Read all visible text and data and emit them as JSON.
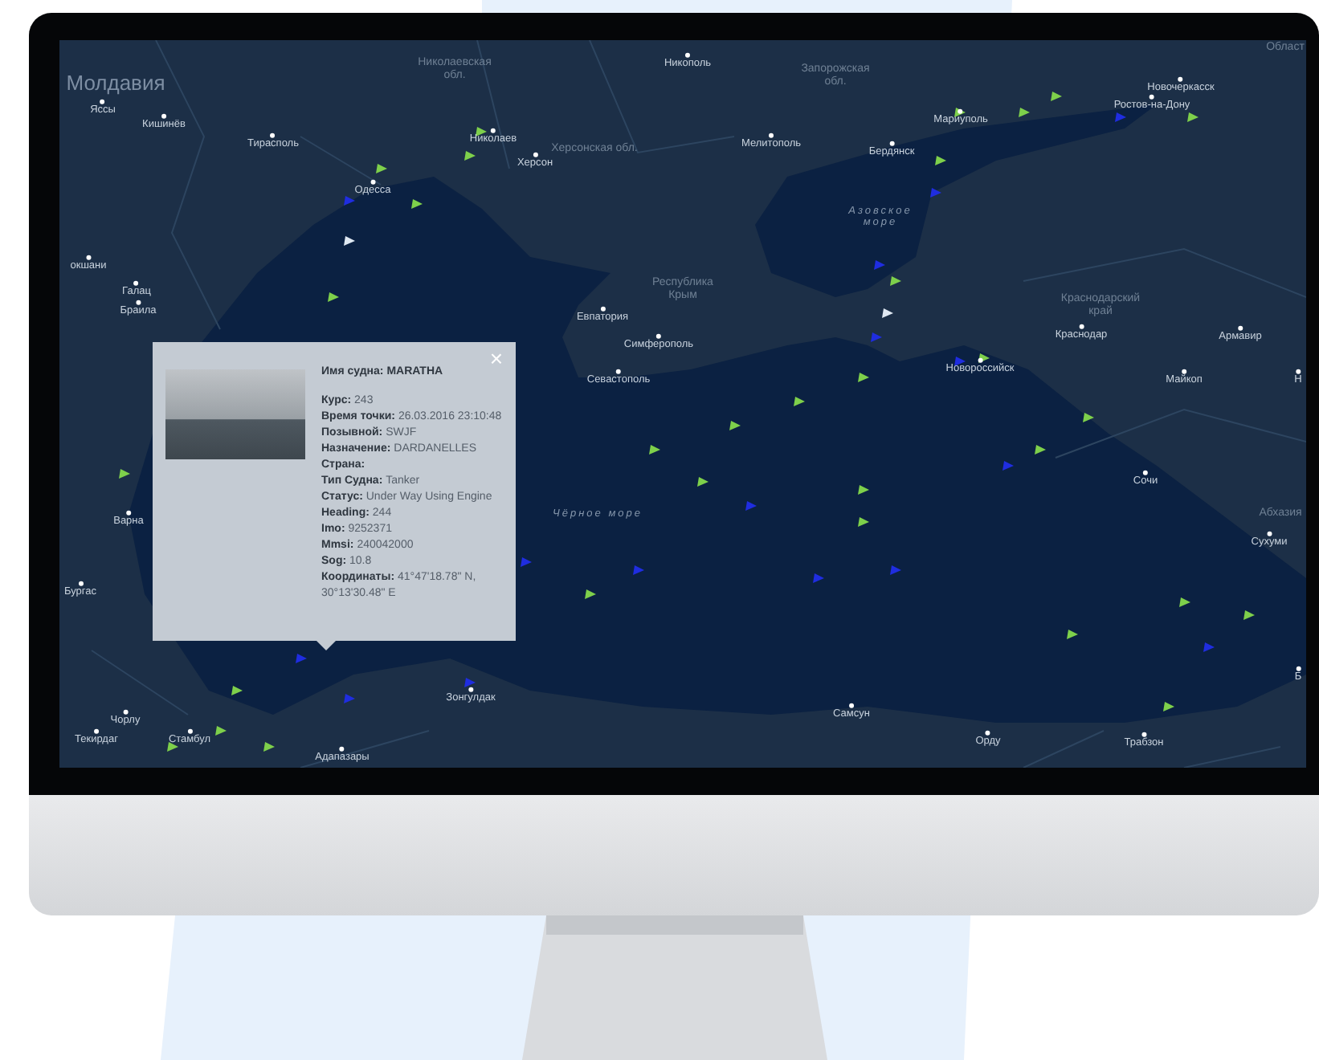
{
  "map": {
    "labels": [
      {
        "text": "Молдавия",
        "kind": "country"
      },
      {
        "text": "Яссы",
        "kind": "city"
      },
      {
        "text": "Кишинёв",
        "kind": "city"
      },
      {
        "text": "Тирасполь",
        "kind": "city"
      },
      {
        "text": "Николаевская обл.",
        "kind": "region"
      },
      {
        "text": "Николаев",
        "kind": "city"
      },
      {
        "text": "Херсон",
        "kind": "city"
      },
      {
        "text": "Херсонская обл.",
        "kind": "region"
      },
      {
        "text": "Одесса",
        "kind": "city"
      },
      {
        "text": "Никополь",
        "kind": "city"
      },
      {
        "text": "Запорожская обл.",
        "kind": "region"
      },
      {
        "text": "Мелитополь",
        "kind": "city"
      },
      {
        "text": "Бердянск",
        "kind": "city"
      },
      {
        "text": "Мариуполь",
        "kind": "city"
      },
      {
        "text": "Новочеркасск",
        "kind": "city"
      },
      {
        "text": "Ростов-на-Дону",
        "kind": "city"
      },
      {
        "text": "Област",
        "kind": "region"
      },
      {
        "text": "окшани",
        "kind": "city"
      },
      {
        "text": "Галац",
        "kind": "city"
      },
      {
        "text": "Браила",
        "kind": "city"
      },
      {
        "text": "Азовское море",
        "kind": "sea"
      },
      {
        "text": "Республика Крым",
        "kind": "region"
      },
      {
        "text": "Евпатория",
        "kind": "city"
      },
      {
        "text": "Симферополь",
        "kind": "city"
      },
      {
        "text": "Севастополь",
        "kind": "city"
      },
      {
        "text": "Краснодарский край",
        "kind": "region"
      },
      {
        "text": "Краснодар",
        "kind": "city"
      },
      {
        "text": "Армавир",
        "kind": "city"
      },
      {
        "text": "Новороссийск",
        "kind": "city"
      },
      {
        "text": "Майкоп",
        "kind": "city"
      },
      {
        "text": "Н",
        "kind": "city"
      },
      {
        "text": "Сочи",
        "kind": "city"
      },
      {
        "text": "Абхазия",
        "kind": "region"
      },
      {
        "text": "Сухуми",
        "kind": "city"
      },
      {
        "text": "Чёрное море",
        "kind": "sea"
      },
      {
        "text": "Варна",
        "kind": "city"
      },
      {
        "text": "Бургас",
        "kind": "city"
      },
      {
        "text": "Зонгулдак",
        "kind": "city"
      },
      {
        "text": "Б",
        "kind": "city"
      },
      {
        "text": "Чорлу",
        "kind": "city"
      },
      {
        "text": "Текирдаг",
        "kind": "city"
      },
      {
        "text": "Стамбул",
        "kind": "city"
      },
      {
        "text": "Адапазары",
        "kind": "city"
      },
      {
        "text": "Самсун",
        "kind": "city"
      },
      {
        "text": "Орду",
        "kind": "city"
      },
      {
        "text": "Трабзон",
        "kind": "city"
      }
    ],
    "popup": {
      "close": "×",
      "fields": [
        {
          "label": "Имя судна:",
          "value": "MARATHA"
        },
        {
          "label": "Курс:",
          "value": "243"
        },
        {
          "label": "Время точки:",
          "value": "26.03.2016 23:10:48"
        },
        {
          "label": "Позывной:",
          "value": "SWJF"
        },
        {
          "label": "Назначение:",
          "value": "DARDANELLES"
        },
        {
          "label": "Страна:"
        },
        {
          "label": "Тип Судна:",
          "value": "Tanker"
        },
        {
          "label": "Статус:",
          "value": "Under Way Using Engine"
        },
        {
          "label": "Heading:",
          "value": "244"
        },
        {
          "label": "Imo:",
          "value": "9252371"
        },
        {
          "label": "Mmsi:",
          "value": "240042000"
        },
        {
          "label": "Sog:",
          "value": "10.8"
        },
        {
          "label": "Координаты:",
          "value": "41°47'18.78\" N, 30°13'30.48\" E"
        }
      ]
    }
  }
}
